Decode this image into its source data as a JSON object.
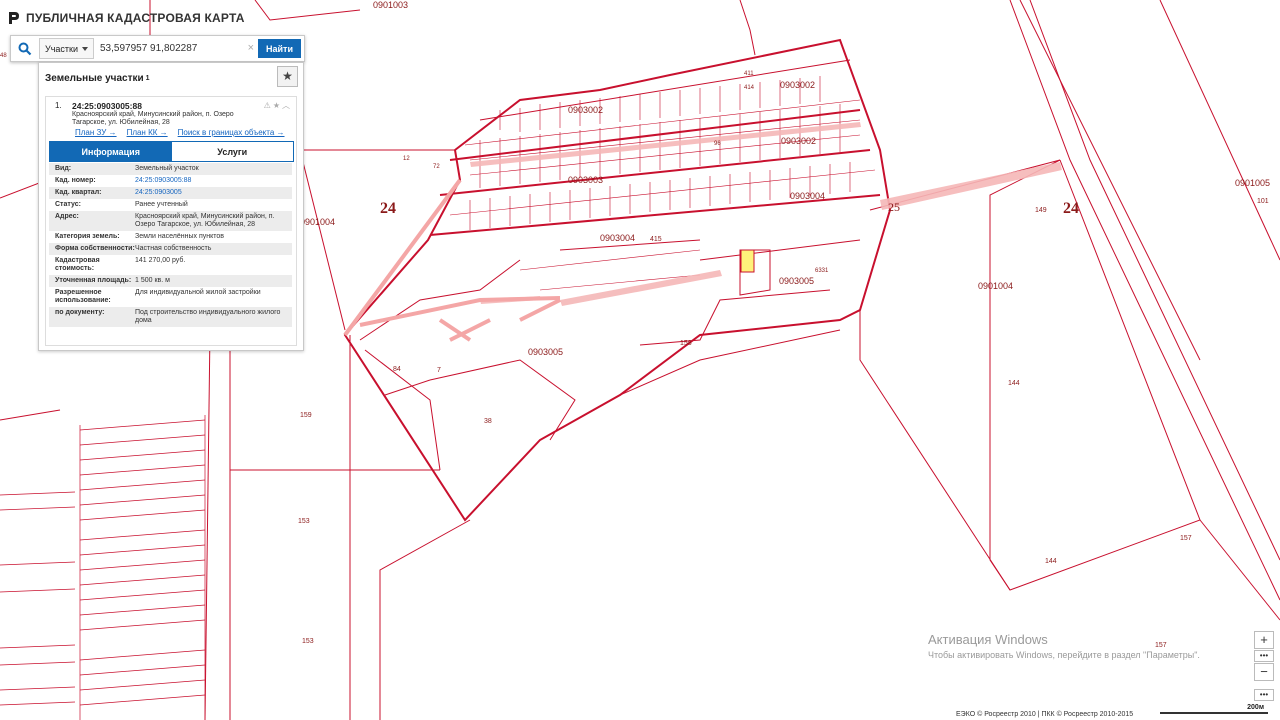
{
  "app": {
    "title": "ПУБЛИЧНАЯ КАДАСТРОВАЯ КАРТА"
  },
  "search": {
    "type_label": "Участки",
    "query": "53,597957 91,802287",
    "find_label": "Найти"
  },
  "panel": {
    "title": "Земельные участки",
    "count": "1",
    "item": {
      "number": "1.",
      "kad_number": "24:25:0903005:88",
      "address": "Красноярский край, Минусинский район, п. Озеро Тагарское, ул. Юбилейная, 28",
      "links": [
        "План ЗУ →",
        "План КК →",
        "Поиск в границах объекта →"
      ]
    },
    "tabs": [
      "Информация",
      "Услуги"
    ],
    "rows": [
      {
        "k": "Вид:",
        "v": "Земельный участок"
      },
      {
        "k": "Кад. номер:",
        "v": "24:25:0903005:88"
      },
      {
        "k": "Кад. квартал:",
        "v": "24:25:0903005"
      },
      {
        "k": "Статус:",
        "v": "Ранее учтенный"
      },
      {
        "k": "Адрес:",
        "v": "Красноярский край, Минусинский район, п. Озеро Тагарское, ул. Юбилейная, 28"
      },
      {
        "k": "Категория земель:",
        "v": "Земли населённых пунктов"
      },
      {
        "k": "Форма собственности:",
        "v": "Частная собственность"
      },
      {
        "k": "Кадастровая стоимость:",
        "v": "141 270,00 руб."
      },
      {
        "k": "Уточненная площадь:",
        "v": "1 500 кв. м"
      },
      {
        "k": "Разрешенное использование:",
        "v": "Для индивидуальной жилой застройки"
      },
      {
        "k": "по документу:",
        "v": "Под строительство индивидуального жилого дома"
      }
    ]
  },
  "map": {
    "colors": {
      "boundary": "#c8102e",
      "road_fill": "#f5b7b7",
      "highlight": "#fff27a"
    },
    "labels": [
      "0901003",
      "0903002",
      "0903002",
      "0903002",
      "0903003",
      "0903004",
      "0903004",
      "0903005",
      "0903005",
      "0901004",
      "0901004",
      "0901005",
      "24",
      "24",
      "25",
      "149",
      "101",
      "144",
      "144",
      "157",
      "157",
      "159",
      "153",
      "153",
      "158",
      "84",
      "7",
      "38",
      "6331",
      "415",
      "411",
      "414",
      "96",
      "12",
      "72",
      "48"
    ]
  },
  "zoom": {
    "plus": "+",
    "minus": "−"
  },
  "footer": {
    "copyright": "ЕЭКО © Росреестр 2010 | ПКК © Росреестр 2010-2015",
    "scale": "200м"
  },
  "watermark": {
    "line1": "Активация Windows",
    "line2": "Чтобы активировать Windows, перейдите в раздел \"Параметры\"."
  }
}
